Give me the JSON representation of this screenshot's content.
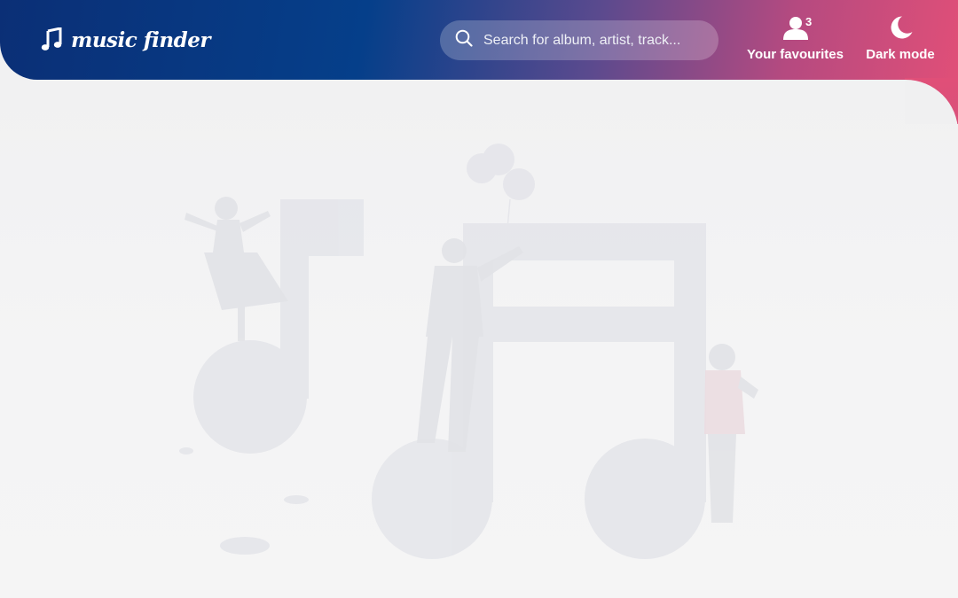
{
  "header": {
    "logo_text": "music finder",
    "logo_icon": "music-note-icon"
  },
  "search": {
    "placeholder": "Search for album, artist, track...",
    "value": "",
    "icon": "search-icon"
  },
  "favourites": {
    "label": "Your favourites",
    "count": "3",
    "icon": "user-icon"
  },
  "theme_toggle": {
    "label": "Dark mode",
    "icon": "moon-icon"
  },
  "colors": {
    "header_gradient_start": "#0b2f76",
    "header_gradient_end": "#e04f78",
    "background": "#f2f2f3"
  }
}
